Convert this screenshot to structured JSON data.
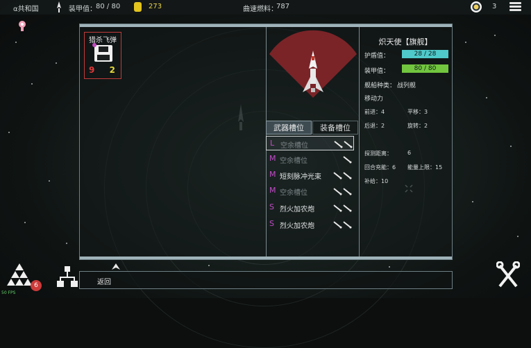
{
  "topbar": {
    "faction": "α共和国",
    "armor_label": "装甲值：",
    "armor_value": "80 / 80",
    "coins": "273",
    "warp_fuel_label": "曲速燃料：",
    "warp_fuel_value": "787",
    "medal_count": "3"
  },
  "cargo": {
    "title": "猎杀飞弹",
    "left_count": "9",
    "right_count": "2"
  },
  "ship": {
    "name": "炽天使【旗舰】",
    "shield_label": "护盾值：",
    "shield_value": "28 / 28",
    "armor_label": "装甲值：",
    "armor_value": "80 / 80",
    "type_label": "舰船种类：",
    "type_value": "战列舰",
    "mobility_label": "移动力",
    "forward": "前进：4",
    "strafe": "平移：3",
    "backward": "后退：2",
    "rotate": "旋转：2",
    "detect": "探测距离：",
    "detect_value": "6",
    "charge": "回合充能：6",
    "energy_cap": "能量上限：15",
    "supply": "补给：10"
  },
  "tabs": {
    "weapon": "武器槽位",
    "equipment": "装备槽位"
  },
  "slots": [
    {
      "letter": "L",
      "name": "空余槽位",
      "empty": true
    },
    {
      "letter": "M",
      "name": "空余槽位",
      "empty": true
    },
    {
      "letter": "M",
      "name": "短刻脉冲光束",
      "empty": false
    },
    {
      "letter": "M",
      "name": "空余槽位",
      "empty": true
    },
    {
      "letter": "S",
      "name": "烈火加农炮",
      "empty": false
    },
    {
      "letter": "S",
      "name": "烈火加农炮",
      "empty": false
    }
  ],
  "bottom": {
    "back_label": "返回",
    "fps": "50 FPS",
    "fleet_badge": "6"
  },
  "colors": {
    "shield_bar": "#4fc9c9",
    "armor_bar": "#72c63f",
    "sector": "#7a2428",
    "slot_letter": "#c24cc8"
  }
}
